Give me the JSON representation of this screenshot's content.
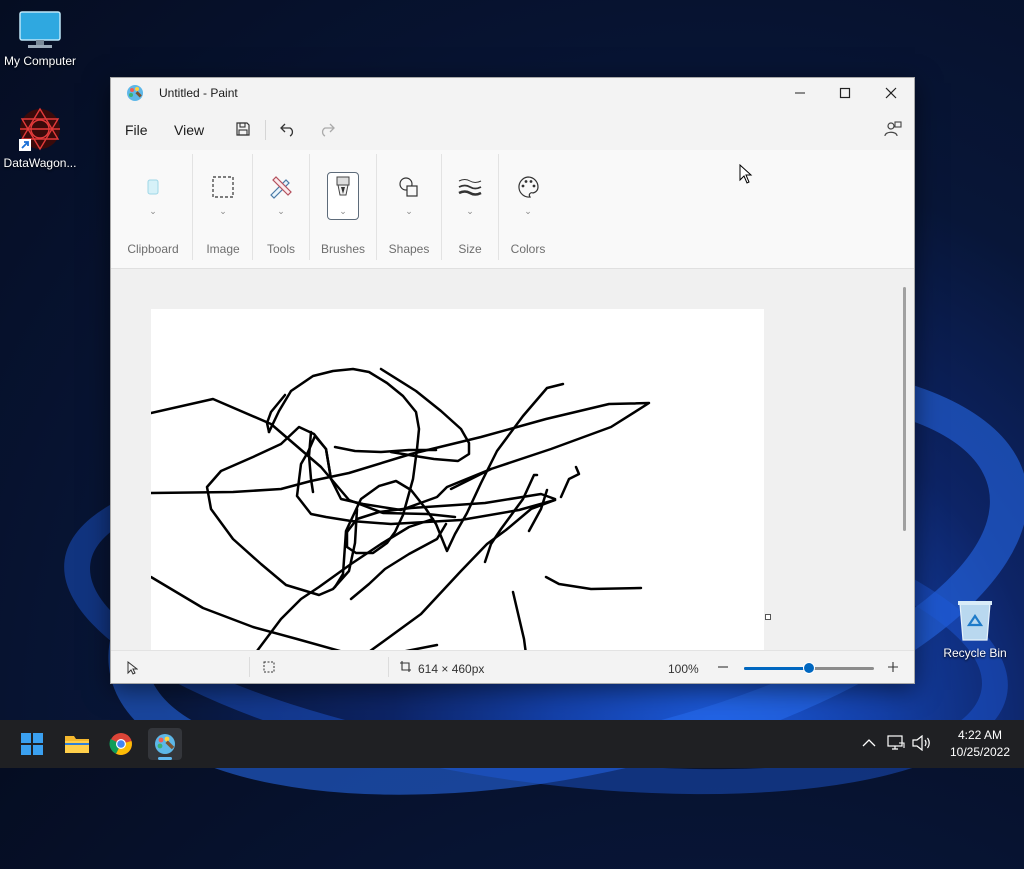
{
  "desktop": {
    "icons": [
      {
        "label": "My Computer",
        "icon": "monitor-icon"
      },
      {
        "label": "DataWagon...",
        "icon": "datawagon-icon"
      },
      {
        "label": "Recycle Bin",
        "icon": "recycle-bin-icon"
      }
    ]
  },
  "window": {
    "title": "Untitled - Paint",
    "menu": {
      "file": "File",
      "view": "View"
    },
    "ribbon": {
      "groups": [
        "Clipboard",
        "Image",
        "Tools",
        "Brushes",
        "Shapes",
        "Size",
        "Colors"
      ]
    },
    "status": {
      "canvas_size": "614 × 460px",
      "zoom": "100%",
      "zoom_level": 0.5
    }
  },
  "taskbar": {
    "apps": [
      "start-icon",
      "file-explorer-icon",
      "chrome-icon",
      "paint-icon"
    ],
    "time": "4:22 AM",
    "date": "10/25/2022"
  }
}
